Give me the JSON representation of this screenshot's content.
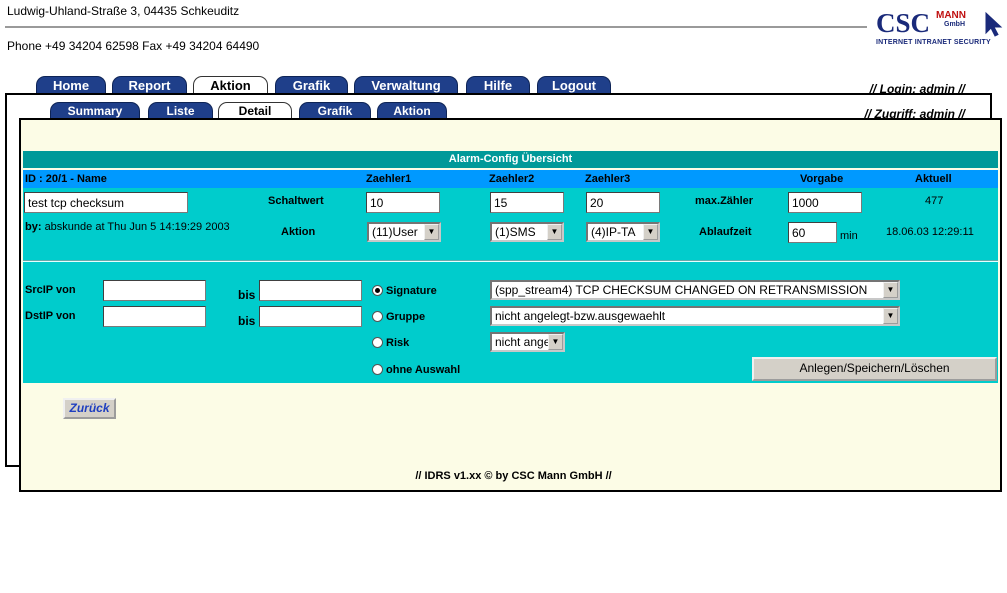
{
  "header": {
    "address": "Ludwig-Uhland-Straße 3, 04435 Schkeuditz",
    "phone": "Phone +49 34204 62598 Fax +49 34204 64490",
    "logo": {
      "csc": "CSC",
      "mann": "MANN",
      "gmbh": "GmbH",
      "tagline": "INTERNET INTRANET SECURITY"
    }
  },
  "main_tabs": [
    {
      "label": "Home"
    },
    {
      "label": "Report"
    },
    {
      "label": "Aktion"
    },
    {
      "label": "Grafik"
    },
    {
      "label": "Verwaltung"
    },
    {
      "label": "Hilfe"
    },
    {
      "label": "Logout"
    }
  ],
  "sub_tabs": [
    {
      "label": "Summary"
    },
    {
      "label": "Liste"
    },
    {
      "label": "Detail"
    },
    {
      "label": "Grafik"
    },
    {
      "label": "Aktion"
    }
  ],
  "login": {
    "prefix": "// Login: ",
    "user": "admin",
    "suffix": " //"
  },
  "zugriff": {
    "prefix": "// Zugriff: ",
    "user": "admin",
    "suffix": " //"
  },
  "form": {
    "title": "Alarm-Config Übersicht",
    "columns": {
      "id_name": "ID : 20/1 - Name",
      "zaehler1": "Zaehler1",
      "zaehler2": "Zaehler2",
      "zaehler3": "Zaehler3",
      "vorgabe": "Vorgabe",
      "aktuell": "Aktuell"
    },
    "name_value": "test tcp checksum",
    "schaltwert_label": "Schaltwert",
    "schaltwert": [
      "10",
      "15",
      "20"
    ],
    "max_zaehler_label": "max.Zähler",
    "max_zaehler_value": "1000",
    "aktuell_value": "477",
    "by_label": "by:",
    "by_value": "abskunde at Thu Jun 5 14:19:29 2003",
    "aktion_label": "Aktion",
    "aktion_selects": [
      "(11)User",
      "(1)SMS",
      "(4)IP-TA"
    ],
    "ablaufzeit_label": "Ablaufzeit",
    "ablaufzeit_value": "60",
    "ablaufzeit_unit": "min",
    "aktuell_time": "18.06.03 12:29:11",
    "srcip_label": "SrcIP von",
    "dstip_label": "DstIP von",
    "bis_label": "bis",
    "srcip_from": "",
    "srcip_to": "",
    "dstip_from": "",
    "dstip_to": "",
    "radios": [
      {
        "label": "Signature",
        "checked": true
      },
      {
        "label": "Gruppe",
        "checked": false
      },
      {
        "label": "Risk",
        "checked": false
      },
      {
        "label": "ohne Auswahl",
        "checked": false
      }
    ],
    "signature_select": "(spp_stream4) TCP CHECKSUM CHANGED ON RETRANSMISSION",
    "gruppe_select": "nicht angelegt-bzw.ausgewaehlt",
    "risk_select": "nicht angelegt",
    "save_button": "Anlegen/Speichern/Löschen"
  },
  "back_button": "Zurück",
  "footer": "//  IDRS v1.xx © by CSC Mann GmbH   //"
}
